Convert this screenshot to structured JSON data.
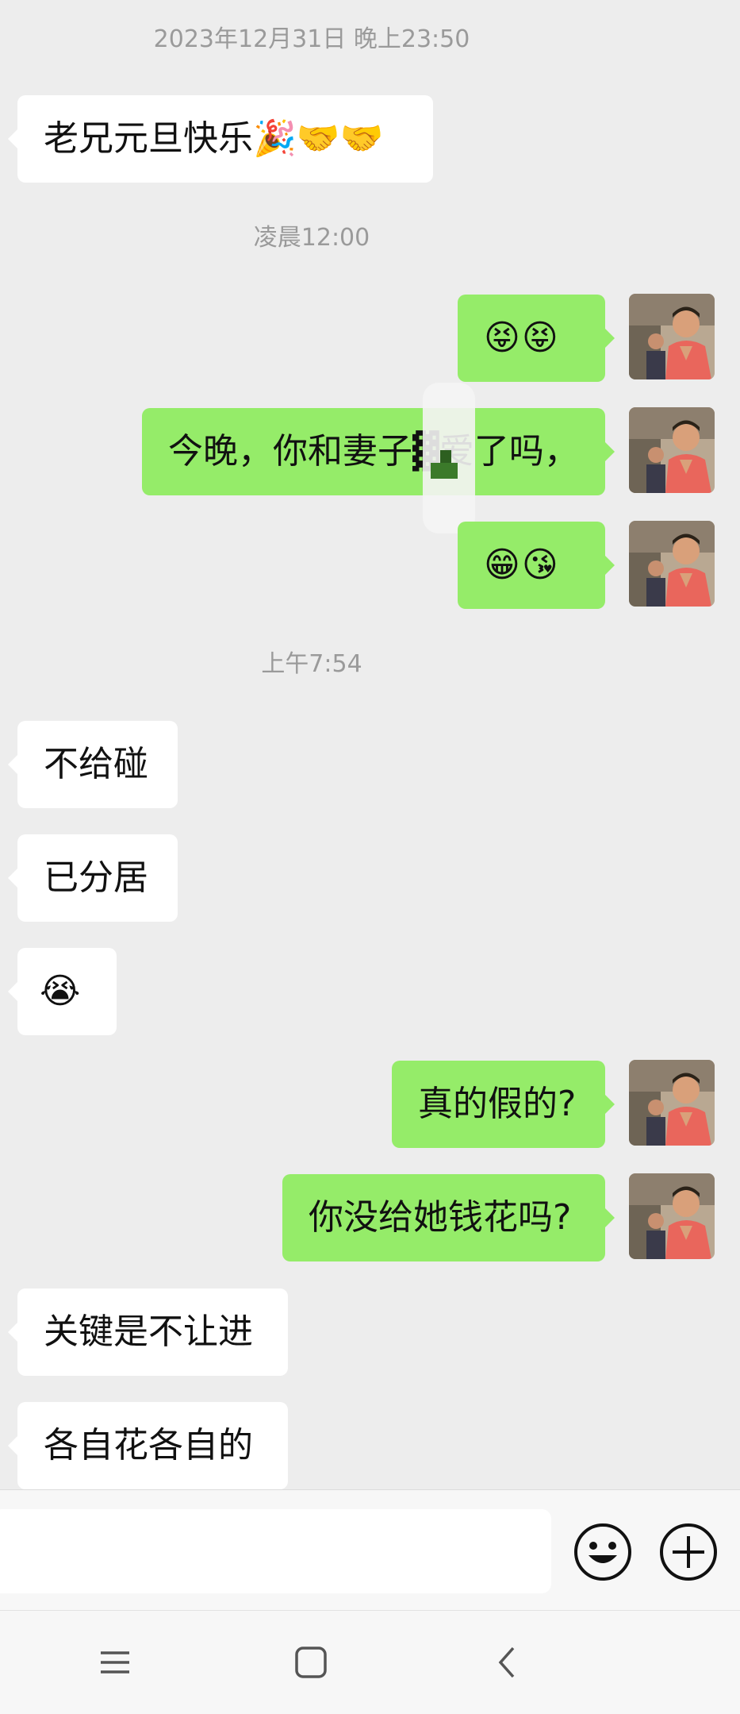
{
  "timestamps": {
    "t1": "2023年12月31日 晚上23:50",
    "t2": "凌晨12:00",
    "t3": "上午7:54"
  },
  "messages": {
    "m1": "老兄元旦快乐🎉🤝🤝",
    "m2": "😝😝",
    "m3": "今晚，你和妻子▓爱了吗，",
    "m4": "😁😘",
    "m5": "不给碰",
    "m6": "已分居",
    "m7": "😭",
    "m8": "真的假的?",
    "m9": "你没给她钱花吗?",
    "m10": "关键是不让进",
    "m11": "各自花各自的"
  },
  "input": {
    "value": "",
    "placeholder": ""
  },
  "icons": {
    "emoji": "emoji-smile-icon",
    "plus": "plus-circle-icon",
    "menu": "menu-icon",
    "home": "home-icon",
    "back": "back-icon"
  },
  "colors": {
    "background": "#ededed",
    "outgoing_bubble": "#95ec69",
    "incoming_bubble": "#ffffff",
    "timestamp": "#9a9a9a"
  }
}
